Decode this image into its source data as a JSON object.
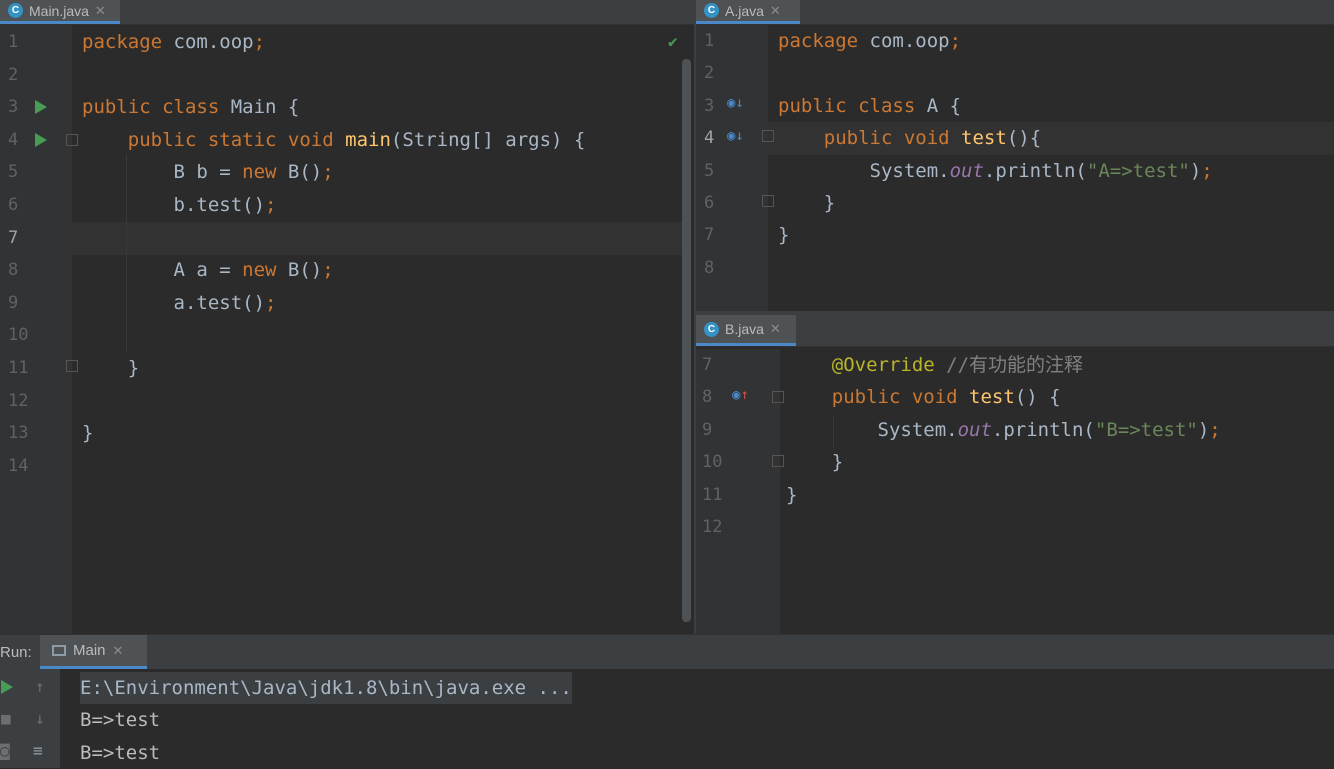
{
  "main_editor": {
    "tab_label": "Main.java",
    "line_numbers": [
      "1",
      "2",
      "3",
      "4",
      "5",
      "6",
      "7",
      "8",
      "9",
      "10",
      "11",
      "12",
      "13",
      "14"
    ],
    "lines": [
      [
        {
          "t": "package",
          "c": "kw"
        },
        {
          "t": " com.oop",
          "c": ""
        },
        {
          "t": ";",
          "c": "kw"
        }
      ],
      [],
      [
        {
          "t": "public class",
          "c": "kw"
        },
        {
          "t": " Main {",
          "c": ""
        }
      ],
      [
        {
          "t": "    public static void",
          "c": "kw"
        },
        {
          "t": " ",
          "c": ""
        },
        {
          "t": "main",
          "c": "fn"
        },
        {
          "t": "(String[] args) {",
          "c": ""
        }
      ],
      [
        {
          "t": "        B b = ",
          "c": ""
        },
        {
          "t": "new",
          "c": "kw"
        },
        {
          "t": " B()",
          "c": ""
        },
        {
          "t": ";",
          "c": "kw"
        }
      ],
      [
        {
          "t": "        b.test()",
          "c": ""
        },
        {
          "t": ";",
          "c": "kw"
        }
      ],
      [],
      [
        {
          "t": "        A a = ",
          "c": ""
        },
        {
          "t": "new",
          "c": "kw"
        },
        {
          "t": " B()",
          "c": ""
        },
        {
          "t": ";",
          "c": "kw"
        }
      ],
      [
        {
          "t": "        a.test()",
          "c": ""
        },
        {
          "t": ";",
          "c": "kw"
        }
      ],
      [],
      [
        {
          "t": "    }",
          "c": ""
        }
      ],
      [],
      [
        {
          "t": "}",
          "c": ""
        }
      ],
      []
    ]
  },
  "a_editor": {
    "tab_label": "A.java",
    "line_numbers": [
      "1",
      "2",
      "3",
      "4",
      "5",
      "6",
      "7",
      "8"
    ],
    "lines": [
      [
        {
          "t": "package",
          "c": "kw"
        },
        {
          "t": " com.oop",
          "c": ""
        },
        {
          "t": ";",
          "c": "kw"
        }
      ],
      [],
      [
        {
          "t": "public class",
          "c": "kw"
        },
        {
          "t": " A {",
          "c": ""
        }
      ],
      [
        {
          "t": "    public void",
          "c": "kw"
        },
        {
          "t": " ",
          "c": ""
        },
        {
          "t": "test",
          "c": "fn"
        },
        {
          "t": "(){",
          "c": ""
        }
      ],
      [
        {
          "t": "        System.",
          "c": ""
        },
        {
          "t": "out",
          "c": "fld"
        },
        {
          "t": ".println(",
          "c": ""
        },
        {
          "t": "\"A=>test\"",
          "c": "str"
        },
        {
          "t": ")",
          "c": ""
        },
        {
          "t": ";",
          "c": "kw"
        }
      ],
      [
        {
          "t": "    }",
          "c": ""
        }
      ],
      [
        {
          "t": "}",
          "c": ""
        }
      ],
      []
    ]
  },
  "b_editor": {
    "tab_label": "B.java",
    "line_numbers": [
      "7",
      "8",
      "9",
      "10",
      "11",
      "12"
    ],
    "lines": [
      [
        {
          "t": "    ",
          "c": ""
        },
        {
          "t": "@Override",
          "c": "ann"
        },
        {
          "t": " //有功能的注释",
          "c": "cmt"
        }
      ],
      [
        {
          "t": "    public void",
          "c": "kw"
        },
        {
          "t": " ",
          "c": ""
        },
        {
          "t": "test",
          "c": "fn"
        },
        {
          "t": "() {",
          "c": ""
        }
      ],
      [
        {
          "t": "        System.",
          "c": ""
        },
        {
          "t": "out",
          "c": "fld"
        },
        {
          "t": ".println(",
          "c": ""
        },
        {
          "t": "\"B=>test\"",
          "c": "str"
        },
        {
          "t": ")",
          "c": ""
        },
        {
          "t": ";",
          "c": "kw"
        }
      ],
      [
        {
          "t": "    }",
          "c": ""
        }
      ],
      [
        {
          "t": "}",
          "c": ""
        }
      ],
      []
    ]
  },
  "run_panel": {
    "label": "Run:",
    "tab_label": "Main",
    "output": [
      "E:\\Environment\\Java\\jdk1.8\\bin\\java.exe ...",
      "B=>test",
      "B=>test"
    ]
  },
  "colors": {
    "keyword": "#cc7832",
    "function": "#ffc66d",
    "string": "#6a8759",
    "field": "#9876aa",
    "annotation": "#bbb529",
    "comment": "#808080",
    "run_green": "#499c54",
    "accent_blue": "#4a88c7"
  }
}
